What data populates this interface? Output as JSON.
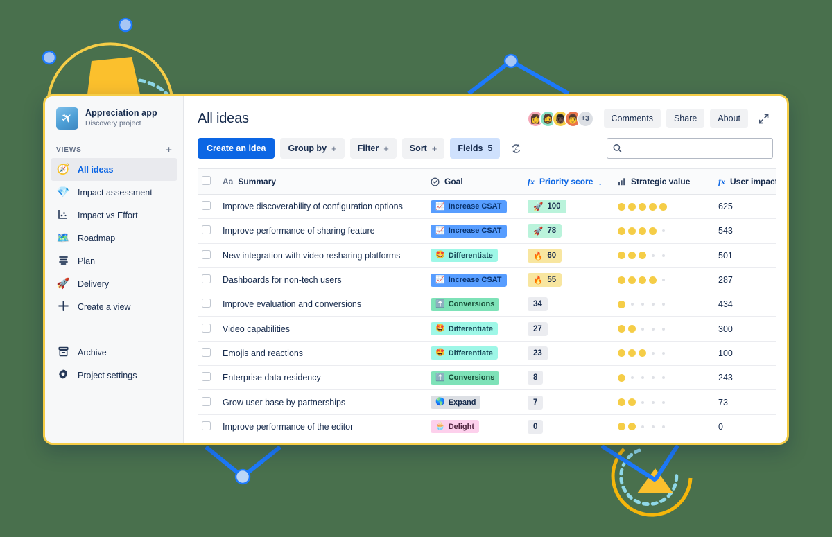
{
  "theme": {
    "background": "#49704d",
    "card_border": "#f5cd47",
    "accent_blue": "#0c66e4",
    "dot_yellow": "#f5cd47"
  },
  "sidebar": {
    "project": {
      "name": "Appreciation app",
      "subtitle": "Discovery project",
      "logo_icon": "airplane-icon"
    },
    "views_header": {
      "label": "VIEWS",
      "add_icon": "plus-icon",
      "add_label": "+"
    },
    "items": [
      {
        "label": "All ideas",
        "icon": "compass-icon",
        "glyph": "🧭",
        "active": true
      },
      {
        "label": "Impact assessment",
        "icon": "diamond-icon",
        "glyph": "💎",
        "active": false
      },
      {
        "label": "Impact vs Effort",
        "icon": "scatter-chart-icon",
        "glyph": "📉",
        "active": false
      },
      {
        "label": "Roadmap",
        "icon": "map-icon",
        "glyph": "🗺️",
        "active": false
      },
      {
        "label": "Plan",
        "icon": "list-icon",
        "glyph": "≡",
        "active": false
      },
      {
        "label": "Delivery",
        "icon": "rocket-icon",
        "glyph": "🚀",
        "active": false
      },
      {
        "label": "Create a view",
        "icon": "plus-icon",
        "glyph": "＋",
        "active": false
      }
    ],
    "bottom_items": [
      {
        "label": "Archive",
        "icon": "archive-icon",
        "glyph": "▤"
      },
      {
        "label": "Project settings",
        "icon": "gear-icon",
        "glyph": "⚙"
      }
    ]
  },
  "header": {
    "title": "All ideas",
    "avatars": [
      {
        "name": "avatar-1",
        "glyph": "👩",
        "bg": "#f6a8b8"
      },
      {
        "name": "avatar-2",
        "glyph": "🧔",
        "bg": "#86e0c4"
      },
      {
        "name": "avatar-3",
        "glyph": "👨🏿",
        "bg": "#f5cd47"
      },
      {
        "name": "avatar-4",
        "glyph": "👨",
        "bg": "#e9744b"
      }
    ],
    "avatar_overflow": "+3",
    "buttons": [
      {
        "label": "Comments",
        "name": "comments-button"
      },
      {
        "label": "Share",
        "name": "share-button"
      },
      {
        "label": "About",
        "name": "about-button"
      }
    ],
    "expand_icon": "expand-icon"
  },
  "toolbar": {
    "create_label": "Create an idea",
    "group_by_label": "Group by",
    "group_by_plus": "+",
    "filter_label": "Filter",
    "filter_plus": "+",
    "sort_label": "Sort",
    "sort_plus": "+",
    "fields_label": "Fields",
    "fields_count": "5",
    "wrap_icon": "text-wrap-icon"
  },
  "search": {
    "value": "",
    "placeholder": "",
    "icon": "search-icon"
  },
  "table": {
    "columns": [
      {
        "key": "checkbox",
        "label": "",
        "icon": "checkbox-icon"
      },
      {
        "key": "summary",
        "label": "Summary",
        "icon": "text-field-icon",
        "icon_glyph": "Aa"
      },
      {
        "key": "goal",
        "label": "Goal",
        "icon": "target-icon",
        "icon_glyph": "⊙"
      },
      {
        "key": "priority",
        "label": "Priority score",
        "icon": "formula-icon",
        "icon_glyph": "fx",
        "sorted": true,
        "sort_dir": "↓"
      },
      {
        "key": "strategic",
        "label": "Strategic value",
        "icon": "bar-chart-icon",
        "icon_glyph": "▃"
      },
      {
        "key": "impact",
        "label": "User impact",
        "icon": "formula-icon",
        "icon_glyph": "fx"
      }
    ],
    "rows": [
      {
        "summary": "Improve discoverability of configuration options",
        "goal": "Increase CSAT",
        "goal_style": "blue",
        "goal_emoji": "📈",
        "priority": "100",
        "priority_style": "p-green",
        "priority_emoji": "🚀",
        "strategic": 5,
        "impact": "625"
      },
      {
        "summary": "Improve performance of sharing feature",
        "goal": "Increase CSAT",
        "goal_style": "blue",
        "goal_emoji": "📈",
        "priority": "78",
        "priority_style": "p-green",
        "priority_emoji": "🚀",
        "strategic": 4,
        "impact": "543"
      },
      {
        "summary": "New integration with video resharing platforms",
        "goal": "Differentiate",
        "goal_style": "teal",
        "goal_emoji": "🤩",
        "priority": "60",
        "priority_style": "p-yellow",
        "priority_emoji": "🔥",
        "strategic": 3,
        "impact": "501"
      },
      {
        "summary": "Dashboards for non-tech users",
        "goal": "Increase CSAT",
        "goal_style": "blue",
        "goal_emoji": "📈",
        "priority": "55",
        "priority_style": "p-yellow",
        "priority_emoji": "🔥",
        "strategic": 4,
        "impact": "287"
      },
      {
        "summary": "Improve evaluation and conversions",
        "goal": "Conversions",
        "goal_style": "green",
        "goal_emoji": "⬆️",
        "priority": "34",
        "priority_style": "p-grey",
        "priority_emoji": "",
        "strategic": 1,
        "impact": "434"
      },
      {
        "summary": "Video capabilities",
        "goal": "Differentiate",
        "goal_style": "teal",
        "goal_emoji": "🤩",
        "priority": "27",
        "priority_style": "p-grey",
        "priority_emoji": "",
        "strategic": 2,
        "impact": "300"
      },
      {
        "summary": "Emojis and reactions",
        "goal": "Differentiate",
        "goal_style": "teal",
        "goal_emoji": "🤩",
        "priority": "23",
        "priority_style": "p-grey",
        "priority_emoji": "",
        "strategic": 3,
        "impact": "100"
      },
      {
        "summary": "Enterprise data residency",
        "goal": "Conversions",
        "goal_style": "green",
        "goal_emoji": "⬆️",
        "priority": "8",
        "priority_style": "p-grey",
        "priority_emoji": "",
        "strategic": 1,
        "impact": "243"
      },
      {
        "summary": "Grow user base by partnerships",
        "goal": "Expand",
        "goal_style": "grey",
        "goal_emoji": "🌎",
        "priority": "7",
        "priority_style": "p-grey",
        "priority_emoji": "",
        "strategic": 2,
        "impact": "73"
      },
      {
        "summary": "Improve performance of the editor",
        "goal": "Delight",
        "goal_style": "pink",
        "goal_emoji": "🧁",
        "priority": "0",
        "priority_style": "p-grey",
        "priority_emoji": "",
        "strategic": 2,
        "impact": "0"
      }
    ],
    "strategic_max": 5
  }
}
